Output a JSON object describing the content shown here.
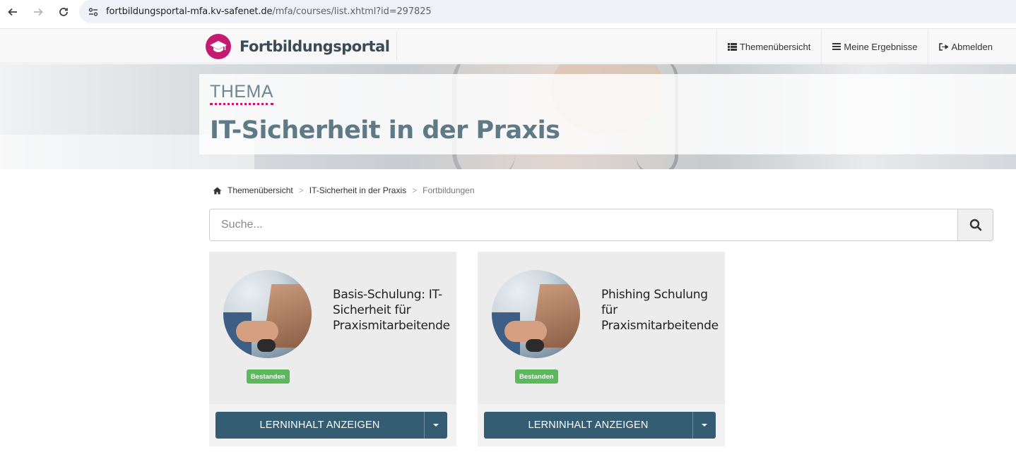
{
  "browser": {
    "url_host": "fortbildungsportal-mfa.kv-safenet.de",
    "url_path": "/mfa/courses/list.xhtml?id=297825"
  },
  "nav": {
    "brand": "Fortbildungsportal",
    "items": [
      {
        "label": "Themenübersicht",
        "icon": "list-icon"
      },
      {
        "label": "Meine Ergebnisse",
        "icon": "menu-icon"
      },
      {
        "label": "Abmelden",
        "icon": "sign-out-icon"
      }
    ]
  },
  "hero": {
    "label": "THEMA",
    "title": "IT-Sicherheit in der Praxis"
  },
  "breadcrumb": {
    "home": "Themenübersicht",
    "topic": "IT-Sicherheit in der Praxis",
    "current": "Fortbildungen"
  },
  "search": {
    "placeholder": "Suche..."
  },
  "courses": [
    {
      "title": "Basis-Schulung: IT-Sicherheit für Praxismitarbeitende",
      "status": "Bestanden",
      "button": "LERNINHALT ANZEIGEN"
    },
    {
      "title": "Phishing Schulung für Praxismitarbeitende",
      "status": "Bestanden",
      "button": "LERNINHALT ANZEIGEN"
    }
  ],
  "colors": {
    "brand": "#c51a6f",
    "button": "#345c72",
    "badge": "#5cb85c"
  }
}
